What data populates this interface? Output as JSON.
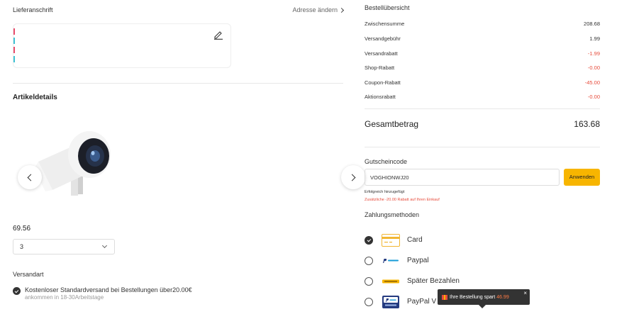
{
  "address": {
    "title": "Lieferanschrift",
    "change_label": "Adresse ändern",
    "icon": "edit-icon"
  },
  "article": {
    "title": "Artikeldetails",
    "price": "69.56",
    "quantity": "3",
    "shipping_label": "Versandart",
    "shipping_option": "Kostenloser Standardversand bei Bestellungen über20.00€",
    "shipping_eta": "ankommen in 18-30Arbeitstage"
  },
  "summary": {
    "title": "Bestellübersicht",
    "rows": [
      {
        "label": "Zwischensumme",
        "value": "208.68"
      },
      {
        "label": "Versandgebühr",
        "value": "1.99"
      },
      {
        "label": "Versandrabatt",
        "value": "-1.99"
      },
      {
        "label": "Shop-Rabatt",
        "value": "-0.00"
      },
      {
        "label": "Coupon-Rabatt",
        "value": "-45.00"
      },
      {
        "label": "Aktionsrabatt",
        "value": "-0.00"
      }
    ],
    "total_label": "Gesamtbetrag",
    "total_value": "163.68"
  },
  "coupon": {
    "label": "Gutscheincode",
    "value": "VOGHIONWJ20",
    "button": "Anwenden",
    "success": "Erfolgreich hinzugefügt",
    "extra": "Zusätzliche -20.00 Rabatt auf Ihren Einkauf"
  },
  "payment": {
    "title": "Zahlungsmethoden",
    "methods": [
      {
        "label": "Card",
        "icon": "card-icon",
        "selected": true
      },
      {
        "label": "Paypal",
        "icon": "paypal-icon",
        "selected": false
      },
      {
        "label": "Später Bezahlen",
        "icon": "paylater-icon",
        "selected": false
      },
      {
        "label": "PayPal V",
        "icon": "paypal-verified-icon",
        "selected": false
      }
    ]
  },
  "tooltip": {
    "text": "Ihre Bestellung spart",
    "amount": "46.99",
    "close": "×"
  },
  "colors": {
    "accent": "#f7b500",
    "discount": "#e74c3c",
    "tooltip_bg": "#333333"
  }
}
